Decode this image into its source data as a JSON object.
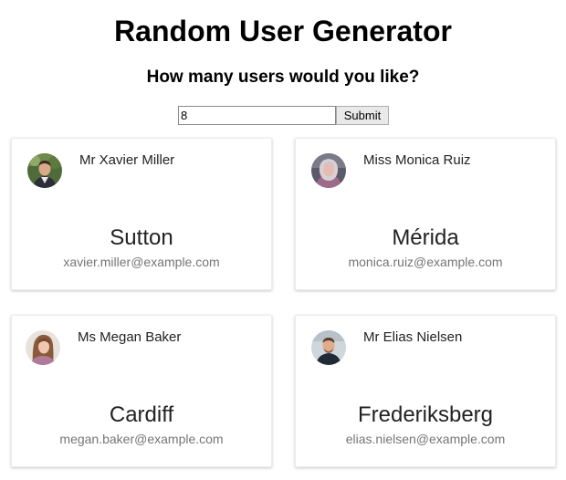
{
  "header": {
    "title": "Random User Generator",
    "prompt": "How many users would you like?"
  },
  "form": {
    "count_value": "8",
    "submit_label": "Submit"
  },
  "users": [
    {
      "name": "Mr Xavier Miller",
      "city": "Sutton",
      "email": "xavier.miller@example.com",
      "avatar_icon": "person-photo-icon"
    },
    {
      "name": "Miss Monica Ruiz",
      "city": "Mérida",
      "email": "monica.ruiz@example.com",
      "avatar_icon": "person-photo-icon"
    },
    {
      "name": "Ms Megan Baker",
      "city": "Cardiff",
      "email": "megan.baker@example.com",
      "avatar_icon": "person-photo-icon"
    },
    {
      "name": "Mr Elias Nielsen",
      "city": "Frederiksberg",
      "email": "elias.nielsen@example.com",
      "avatar_icon": "person-photo-icon"
    }
  ]
}
